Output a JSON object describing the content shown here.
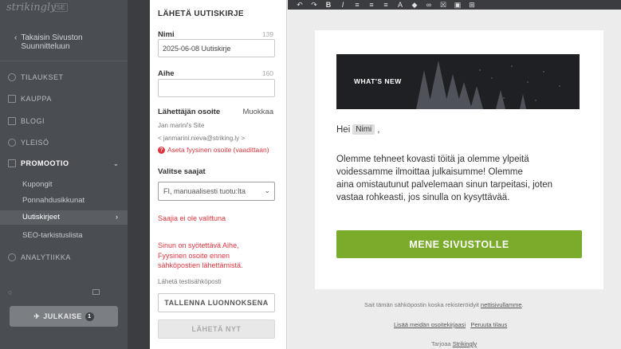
{
  "sidebar": {
    "brand": "strikingly",
    "brand_badge": "SE",
    "back_line1": "Takaisin Sivuston",
    "back_line2": "Suunnitteluun",
    "nav": [
      {
        "label": "TILAUKSET"
      },
      {
        "label": "KAUPPA"
      },
      {
        "label": "BLOGI"
      },
      {
        "label": "YLEISÖ"
      },
      {
        "label": "PROMOOTIO"
      },
      {
        "label": "ANALYTIIKKA"
      }
    ],
    "sub": [
      "Kupongit",
      "Ponnahdusikkunat",
      "Uutiskirjeet",
      "SEO-tarkistuslista"
    ],
    "publish_label": "JULKAISE",
    "publish_count": "1"
  },
  "panel": {
    "title": "LÄHETÄ UUTISKIRJE",
    "name_label": "Nimi",
    "name_counter": "139",
    "name_value": "2025-06-08 Uutiskirje",
    "subject_label": "Aihe",
    "subject_counter": "160",
    "subject_value": "",
    "sender_label": "Lähettäjän osoite",
    "sender_edit": "Muokkaa",
    "sender_name": "Jan marini's Site",
    "sender_email": "< janmarini.nieva@striking.ly >",
    "address_warning": "Aseta fyysinen osoite (vaadittaan)",
    "recipients_label": "Valitse saajat",
    "recipients_select": "FI, manuaalisesti tuotu:Ita",
    "no_recipients": "Saajia ei ole valittuna",
    "error_message_line1": "Sinun on syötettävä Aihe,",
    "error_message_line2": "Fyysinen osoite ennen",
    "error_message_line3": "sähköpostien lähettämistä.",
    "test_email": "Lähetä testisähköposti",
    "save_draft": "TALLENNA LUONNOKSENA",
    "send_now": "LÄHETÄ NYT"
  },
  "toolbar": {
    "icons": [
      "undo-icon",
      "redo-icon",
      "bold-icon",
      "italic-icon",
      "align-left-icon",
      "align-center-icon",
      "align-right-icon",
      "font-color-icon",
      "text-size-icon",
      "link-icon",
      "unlink-icon",
      "image-icon",
      "code-icon"
    ]
  },
  "email": {
    "hero_title": "WHAT'S NEW",
    "greeting": "Hei",
    "name_placeholder": "Nimi",
    "greeting_suffix": ",",
    "body_line1": "Olemme tehneet kovasti töitä ja olemme ylpeitä",
    "body_line2": "voidessamme ilmoittaa julkaisumme! Olemme",
    "body_line3": "aina omistautunut palvelemaan sinun tarpeitasi, joten",
    "body_line4": "vastaa rohkeasti, jos sinulla on kysyttävää.",
    "cta": "MENE SIVUSTOLLE",
    "cta_color": "#7bab2a"
  },
  "footer": {
    "reason": "Sait tämän sähköpostin koska rekisteröidyit",
    "reason_link": "nettisivullamme",
    "reason_end": ".",
    "add_contacts": "Lisää meidän osoitekirjaasi",
    "unsubscribe": "Peruuta tilaus",
    "powered": "Tarjoaa",
    "powered_link": "Strikingly"
  }
}
